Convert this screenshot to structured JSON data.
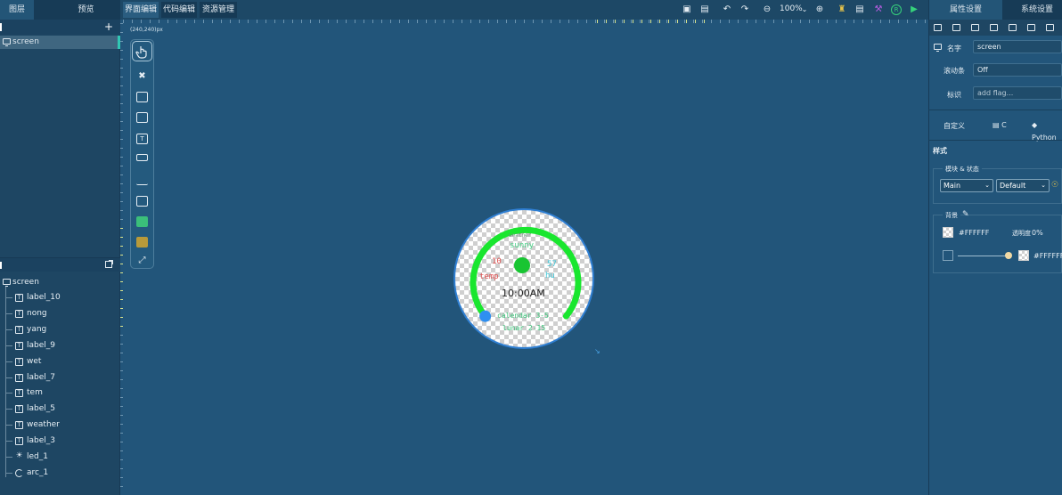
{
  "left_panel": {
    "tabs": [
      {
        "label": "图层"
      },
      {
        "label": "预览"
      }
    ],
    "layer_screen": "screen",
    "tree_root": "screen",
    "tree_items": [
      {
        "label": "label_10",
        "icon": "text-icon"
      },
      {
        "label": "nong",
        "icon": "text-icon"
      },
      {
        "label": "yang",
        "icon": "text-icon"
      },
      {
        "label": "label_9",
        "icon": "text-icon"
      },
      {
        "label": "wet",
        "icon": "text-icon"
      },
      {
        "label": "label_7",
        "icon": "text-icon"
      },
      {
        "label": "tem",
        "icon": "text-icon"
      },
      {
        "label": "label_5",
        "icon": "text-icon"
      },
      {
        "label": "weather",
        "icon": "text-icon"
      },
      {
        "label": "label_3",
        "icon": "text-icon"
      },
      {
        "label": "led_1",
        "icon": "led-icon"
      },
      {
        "label": "arc_1",
        "icon": "arc-icon"
      }
    ]
  },
  "top_tabs": [
    {
      "label": "界面编辑"
    },
    {
      "label": "代码编辑"
    },
    {
      "label": "资源管理"
    }
  ],
  "toolbar": {
    "zoom": "100%"
  },
  "canvas": {
    "size_label": "(240,240)px",
    "watch": {
      "weather_title": "weather",
      "weather": "sunny",
      "temp_value": "10",
      "temp_label": "temp",
      "hum_value": "57",
      "hum_label": "hu",
      "time": "10:00AM",
      "calendar": "calendar 3-5",
      "lunar": "lunar 2-15",
      "arc_color": "#19e62e",
      "led_color": "#18c532",
      "knob_color": "#2f8ff0"
    }
  },
  "right_panel": {
    "tabs": [
      {
        "label": "属性设置"
      },
      {
        "label": "系统设置"
      }
    ],
    "name_label": "名字",
    "name_value": "screen",
    "scroll_label": "滚动条",
    "scroll_value": "Off",
    "flag_label": "标识",
    "flag_placeholder": "add flag...",
    "custom_label": "自定义",
    "c_button": "C",
    "python_button": "Python",
    "style_title": "样式",
    "part_state_title": "模块 & 状态",
    "part_value": "Main",
    "state_value": "Default",
    "bg_title": "背景",
    "bg_color": "#FFFFFF",
    "opacity_label": "透明度",
    "opacity_value": "0%",
    "grad_color": "#FFFFFF"
  }
}
